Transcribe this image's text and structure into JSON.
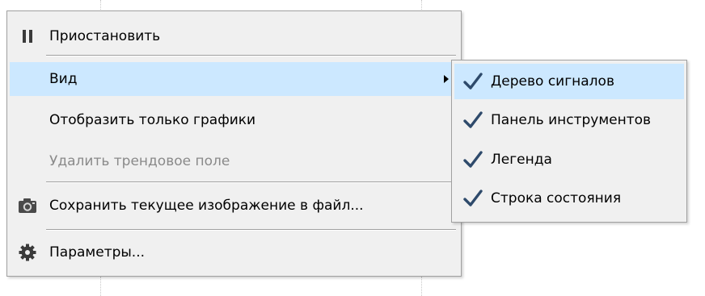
{
  "colors": {
    "menu_background": "#f0f0f0",
    "menu_border": "#a0a0a0",
    "highlight": "#cce8ff",
    "disabled_text": "#8a8a8a",
    "check_mark": "#2e4a6b",
    "icon_dark": "#3a3a3a"
  },
  "context_menu": {
    "items": [
      {
        "label": "Приостановить",
        "icon": "pause-icon"
      },
      {
        "label": "Вид",
        "submenu": true,
        "highlighted": true
      },
      {
        "label": "Отобразить только графики"
      },
      {
        "label": "Удалить трендовое поле",
        "disabled": true
      },
      {
        "label": "Сохранить текущее изображение в файл...",
        "icon": "camera-icon"
      },
      {
        "label": "Параметры...",
        "icon": "gear-icon"
      }
    ]
  },
  "view_submenu": {
    "items": [
      {
        "label": "Дерево сигналов",
        "checked": true,
        "highlighted": true
      },
      {
        "label": "Панель инструментов",
        "checked": true
      },
      {
        "label": "Легенда",
        "checked": true
      },
      {
        "label": "Строка состояния",
        "checked": true
      }
    ]
  }
}
